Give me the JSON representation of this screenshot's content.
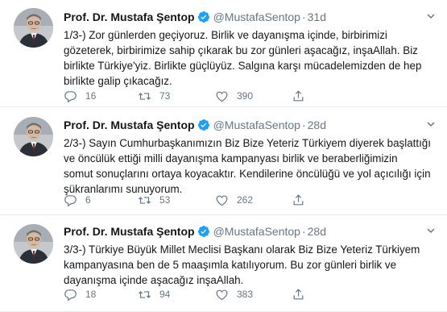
{
  "colors": {
    "text": "#14171a",
    "muted": "#657786",
    "verified": "#1da1f2",
    "divider": "#e6ecf0"
  },
  "icons": {
    "reply": "reply-icon",
    "retweet": "retweet-icon",
    "like": "like-icon",
    "share": "share-icon",
    "verified": "verified-badge-icon",
    "more": "chevron-down-icon"
  },
  "tweets": [
    {
      "name": "Prof. Dr. Mustafa Şentop",
      "handle": "@MustafaSentop",
      "separator": "·",
      "time": "31d",
      "lines": [
        "1/3-) Zor günlerden geçiyoruz. Birlik ve dayanışma içinde, birbirimizi",
        "gözeterek, birbirimize sahip çıkarak bu zor günleri aşacağız, inşaAllah. Biz",
        "birlikte Türkiye'yiz. Birlikte güçlüyüz. Salgına karşı mücadelemizden de hep",
        "birlikte galip çıkacağız."
      ],
      "replies": "16",
      "retweets": "73",
      "likes": "390"
    },
    {
      "name": "Prof. Dr. Mustafa Şentop",
      "handle": "@MustafaSentop",
      "separator": "·",
      "time": "28d",
      "lines": [
        "2/3-) Sayın Cumhurbaşkanımızın Biz Bize Yeteriz Türkiyem diyerek başlattığı",
        "ve öncülük ettiği milli dayanışma kampanyası birlik ve beraberliğimizin",
        "somut sonuçlarını ortaya koyacaktır. Kendilerine öncülüğü ve yol açıcılığı için",
        "şükranlarımı sunuyorum."
      ],
      "replies": "6",
      "retweets": "53",
      "likes": "262"
    },
    {
      "name": "Prof. Dr. Mustafa Şentop",
      "handle": "@MustafaSentop",
      "separator": "·",
      "time": "28d",
      "lines": [
        "3/3-) Türkiye Büyük Millet Meclisi Başkanı olarak Biz Bize Yeteriz Türkiyem",
        "kampanyasına ben de 5 maaşımla katılıyorum. Bu zor günleri birlik ve",
        "dayanışma içinde aşacağız inşaAllah."
      ],
      "replies": "18",
      "retweets": "94",
      "likes": "383"
    }
  ]
}
